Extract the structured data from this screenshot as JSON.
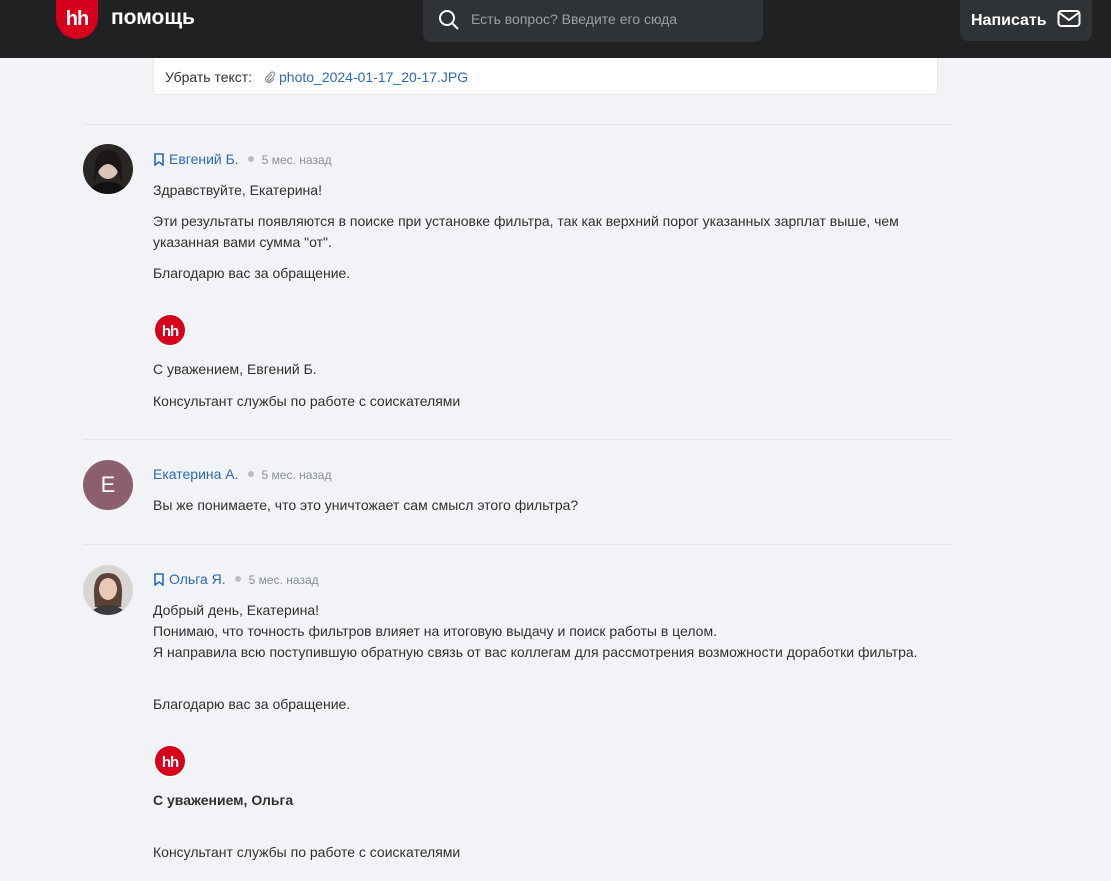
{
  "header": {
    "logo_text": "hh",
    "brand": "помощь",
    "search_placeholder": "Есть вопрос? Введите его сюда",
    "write_button": "Написать"
  },
  "attachment": {
    "label": "Убрать текст:",
    "file": "photo_2024-01-17_20-17.JPG"
  },
  "comments": [
    {
      "author": "Евгений Б.",
      "time": "5 мес. назад",
      "lines": [
        "Здравствуйте, Екатерина!",
        "Эти результаты появляются в поиске при установке фильтра, так как верхний порог указанных зарплат выше, чем указанная вами сумма \"от\".",
        "Благодарю вас за обращение."
      ],
      "signature_logo": "hh",
      "signature": "С уважением, Евгений Б.",
      "role": "Консультант службы по работе с соискателями"
    },
    {
      "author": "Екатерина А.",
      "avatar_letter": "E",
      "time": "5 мес. назад",
      "lines": [
        "Вы же понимаете, что это уничтожает сам смысл этого фильтра?"
      ]
    },
    {
      "author": "Ольга Я.",
      "time": "5 мес. назад",
      "lines": [
        "Добрый день, Екатерина!",
        "Понимаю, что точность фильтров влияет на итоговую выдачу и поиск работы в целом.",
        "Я направила всю поступившую обратную связь от вас коллегам для рассмотрения возможности доработки фильтра.",
        "Благодарю вас за обращение."
      ],
      "signature_logo": "hh",
      "signature": "С уважением, Ольга",
      "role": "Консультант службы по работе с соискателями"
    }
  ],
  "colors": {
    "header_bg": "#1f2123",
    "brand_red": "#d6001c",
    "link": "#2b6ab3",
    "page_bg": "#f1f3f6"
  }
}
